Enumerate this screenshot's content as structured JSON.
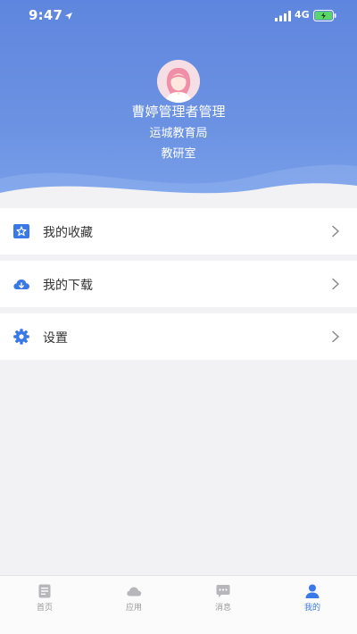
{
  "status_bar": {
    "time": "9:47",
    "network": "4G"
  },
  "profile": {
    "name": "曹婷管理者管理",
    "organization": "运城教育局",
    "department": "教研室"
  },
  "menu": {
    "items": [
      {
        "label": "我的收藏",
        "icon": "star-icon"
      },
      {
        "label": "我的下载",
        "icon": "cloud-download-icon"
      },
      {
        "label": "设置",
        "icon": "gear-icon"
      }
    ]
  },
  "tabbar": {
    "items": [
      {
        "label": "首页",
        "icon": "document-icon"
      },
      {
        "label": "应用",
        "icon": "cloud-icon"
      },
      {
        "label": "消息",
        "icon": "chat-icon"
      },
      {
        "label": "我的",
        "icon": "person-icon"
      }
    ],
    "active_index": 3
  },
  "colors": {
    "header": "#6b92e2",
    "accent": "#3b78e7",
    "inactive_tab": "#9a9a9a",
    "background": "#f2f2f4"
  }
}
